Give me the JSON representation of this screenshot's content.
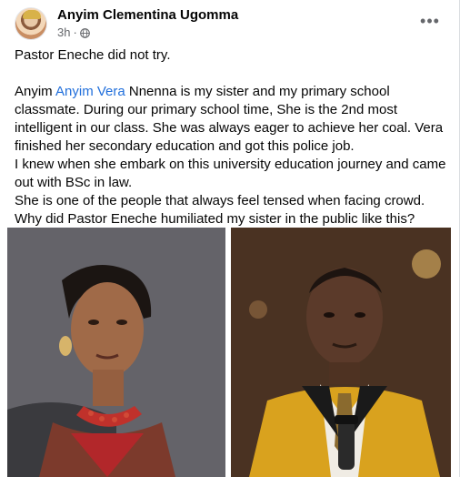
{
  "post": {
    "author": "Anyim Clementina Ugomma",
    "time": "3h",
    "separator": "·",
    "privacy_icon": "globe-icon",
    "more_label": "•••",
    "paragraphs": {
      "p1": "Pastor Eneche did not try.",
      "p2_before": "Anyim ",
      "p2_mention": "Anyim Vera",
      "p2_after": " Nnenna is my sister and my primary school classmate. During our primary school time, She is the 2nd most intelligent in our class. She was always eager to achieve her coal. Vera finished her secondary education and got this police job.",
      "p3": "I knew when she embark on this university education journey and came out with BSc in law.",
      "p4": "She is one of the people that always feel tensed when facing crowd. Why did Pastor Eneche humiliated my sister in the public like this?"
    }
  },
  "colors": {
    "name": "#050505",
    "meta": "#65676b",
    "mention": "#216fdb",
    "card_bg": "#ffffff"
  }
}
